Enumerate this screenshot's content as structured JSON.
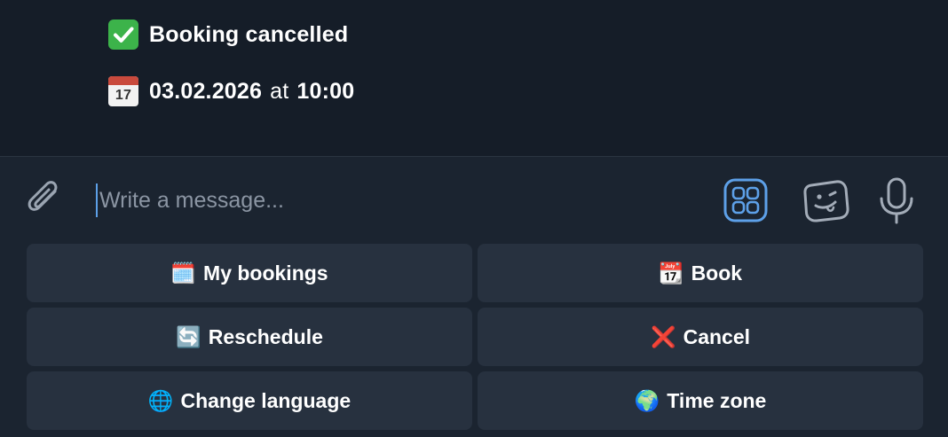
{
  "messages": {
    "status": {
      "emoji": "✅",
      "text": "Booking cancelled"
    },
    "datetime": {
      "emoji": "📆",
      "date": "03.02.2026",
      "at": "at",
      "time": "10:00",
      "calendar_day": "17"
    }
  },
  "composer": {
    "placeholder": "Write a message...",
    "accent_color": "#5da0e8"
  },
  "keyboard": {
    "buttons": [
      {
        "emoji": "🗓️",
        "label": "My bookings"
      },
      {
        "emoji": "📆",
        "label": "Book"
      },
      {
        "emoji": "🔄",
        "label": "Reschedule"
      },
      {
        "emoji": "❌",
        "label": "Cancel"
      },
      {
        "emoji": "🌐",
        "label": "Change language"
      },
      {
        "emoji": "🌍",
        "label": "Time zone"
      }
    ]
  },
  "icons": {
    "attach": "paperclip-icon",
    "apps": "apps-grid-icon",
    "sticker": "sticker-icon",
    "voice": "microphone-icon"
  }
}
